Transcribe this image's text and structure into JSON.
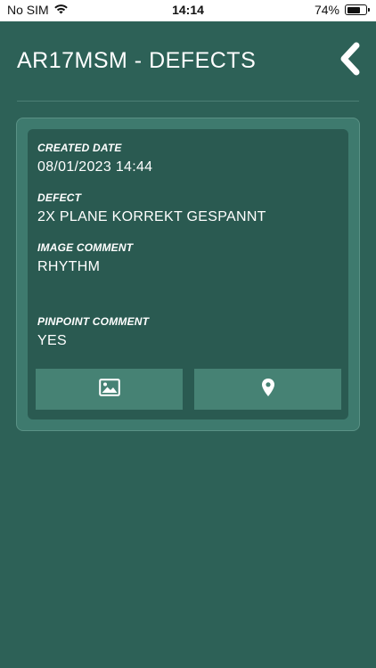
{
  "status_bar": {
    "carrier": "No SIM",
    "time": "14:14",
    "battery_percent": "74%",
    "battery_level": 0.74,
    "icons": [
      "wifi-icon",
      "battery-icon"
    ]
  },
  "header": {
    "title": "AR17MSM - DEFECTS",
    "back_icon": "chevron-left-icon"
  },
  "defect": {
    "created_date_label": "CREATED DATE",
    "created_date_value": "08/01/2023 14:44",
    "defect_label": "DEFECT",
    "defect_value": "2X PLANE KORREKT GESPANNT",
    "image_comment_label": "IMAGE COMMENT",
    "image_comment_value": "RHYTHM",
    "pinpoint_comment_label": "PINPOINT COMMENT",
    "pinpoint_comment_value": "YES"
  },
  "actions": {
    "image_icon": "image-icon",
    "pinpoint_icon": "map-pin-icon"
  },
  "colors": {
    "background": "#2d6157",
    "card_outer": "#3e7a6e",
    "card_inner": "#2a5a51",
    "button": "#468274",
    "text": "#ffffff"
  }
}
